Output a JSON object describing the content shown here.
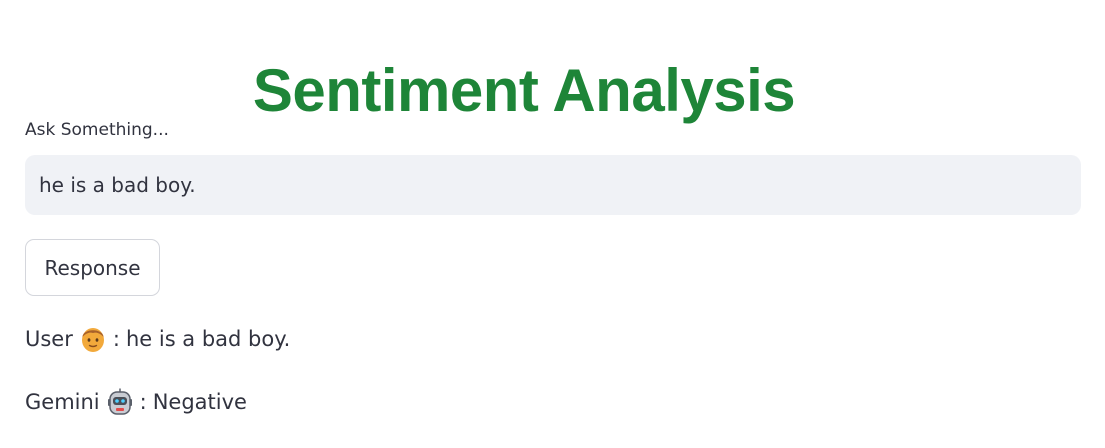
{
  "title": "Sentiment Analysis",
  "input": {
    "label": "Ask Something...",
    "value": "he is a bad boy."
  },
  "button": {
    "label": "Response"
  },
  "messages": {
    "user": {
      "speaker": "User",
      "icon": "boy-emoji-icon",
      "separator": ":",
      "text": "he is a bad boy."
    },
    "gemini": {
      "speaker": "Gemini",
      "icon": "robot-emoji-icon",
      "separator": ":",
      "text": "Negative"
    }
  },
  "colors": {
    "title": "#1e8538",
    "text": "#31333f",
    "input_bg": "#f0f2f6",
    "button_border": "#d4d6dc"
  }
}
